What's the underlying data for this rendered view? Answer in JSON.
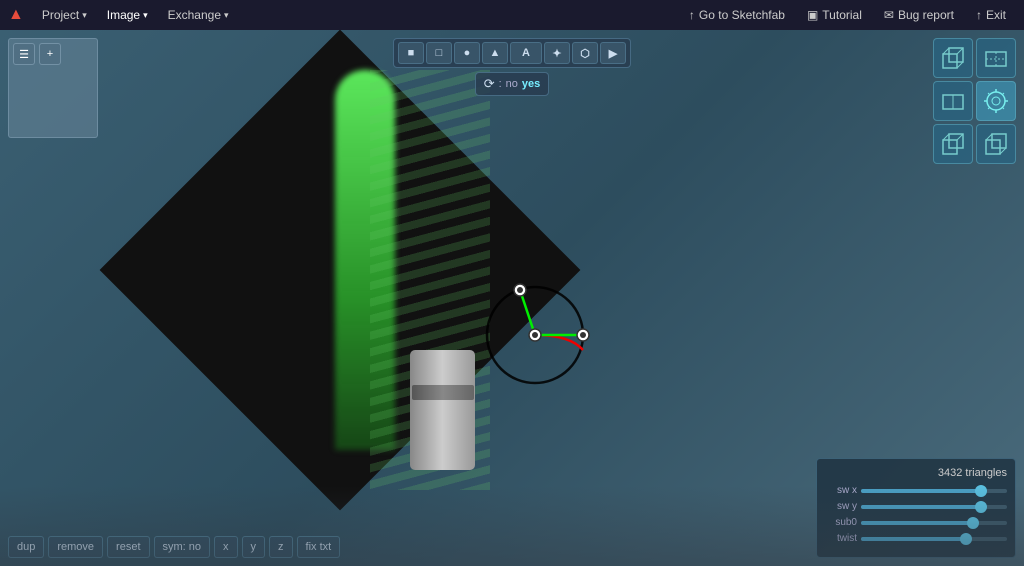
{
  "topbar": {
    "logo": "▲",
    "menus": [
      {
        "label": "Project",
        "has_dropdown": true
      },
      {
        "label": "Image",
        "has_dropdown": true,
        "active": true
      },
      {
        "label": "Exchange",
        "has_dropdown": true
      }
    ],
    "right_actions": [
      {
        "label": "Go to Sketchfab",
        "icon": "↑",
        "id": "sketchfab"
      },
      {
        "label": "Tutorial",
        "icon": "▣",
        "id": "tutorial"
      },
      {
        "label": "Bug report",
        "icon": "✉",
        "id": "bugreport"
      },
      {
        "label": "Exit",
        "icon": "↑",
        "id": "exit"
      }
    ]
  },
  "toolbar": {
    "tools": [
      {
        "id": "square",
        "label": "■",
        "active": false
      },
      {
        "id": "rect",
        "label": "□",
        "active": false
      },
      {
        "id": "circle",
        "label": "●",
        "active": false
      },
      {
        "id": "triangle",
        "label": "▲",
        "active": false
      },
      {
        "id": "text",
        "label": "A",
        "active": false
      },
      {
        "id": "star",
        "label": "✦",
        "active": false
      },
      {
        "id": "hex",
        "label": "⬡",
        "active": false
      },
      {
        "id": "arrow",
        "label": "▶",
        "active": false
      }
    ],
    "sym_label": "⟳ : no",
    "sym_no": "no",
    "sym_yes": "yes"
  },
  "bottom_toolbar": {
    "buttons": [
      {
        "id": "dup",
        "label": "dup"
      },
      {
        "id": "remove",
        "label": "remove"
      },
      {
        "id": "reset",
        "label": "reset"
      },
      {
        "id": "sym",
        "label": "sym: no"
      },
      {
        "id": "x",
        "label": "x"
      },
      {
        "id": "y",
        "label": "y"
      },
      {
        "id": "z",
        "label": "z"
      },
      {
        "id": "fix",
        "label": "fix txt"
      }
    ]
  },
  "bottom_right": {
    "tri_count": "3432 triangles",
    "sliders": [
      {
        "label": "sw x",
        "value": 85
      },
      {
        "label": "sw y",
        "value": 85
      },
      {
        "label": "sub0",
        "value": 80
      },
      {
        "label": "twist",
        "value": 75
      }
    ]
  },
  "view_cube": {
    "buttons": [
      {
        "id": "top-left-cube",
        "type": "corner"
      },
      {
        "id": "top-right-cube",
        "type": "face"
      },
      {
        "id": "mid-left-cube",
        "type": "face"
      },
      {
        "id": "mid-center-cube",
        "type": "sun",
        "active": true
      },
      {
        "id": "bot-left-cube",
        "type": "face"
      },
      {
        "id": "bot-right-cube",
        "type": "corner"
      }
    ]
  },
  "colors": {
    "topbar_bg": "#1a1a2e",
    "viewport_bg": "#4a6b7c",
    "accent": "#4a9fc4",
    "blade_green": "#50ff50"
  }
}
